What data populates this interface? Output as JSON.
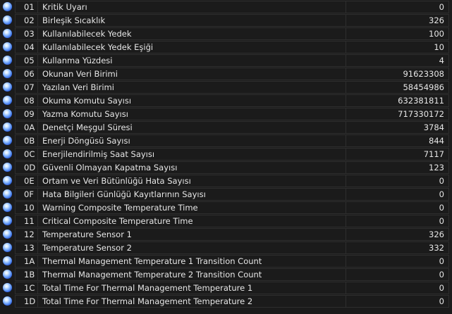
{
  "rows": [
    {
      "id": "01",
      "name": "Kritik Uyarı",
      "value": "0"
    },
    {
      "id": "02",
      "name": "Birleşik Sıcaklık",
      "value": "326"
    },
    {
      "id": "03",
      "name": "Kullanılabilecek Yedek",
      "value": "100"
    },
    {
      "id": "04",
      "name": "Kullanılabilecek Yedek Eşiği",
      "value": "10"
    },
    {
      "id": "05",
      "name": "Kullanma Yüzdesi",
      "value": "4"
    },
    {
      "id": "06",
      "name": "Okunan Veri Birimi",
      "value": "91623308"
    },
    {
      "id": "07",
      "name": "Yazılan Veri Birimi",
      "value": "58454986"
    },
    {
      "id": "08",
      "name": "Okuma Komutu Sayısı",
      "value": "632381811"
    },
    {
      "id": "09",
      "name": "Yazma Komutu Sayısı",
      "value": "717330172"
    },
    {
      "id": "0A",
      "name": "Denetçi Meşgul Süresi",
      "value": "3784"
    },
    {
      "id": "0B",
      "name": "Enerji Döngüsü Sayısı",
      "value": "844"
    },
    {
      "id": "0C",
      "name": "Enerjilendirilmiş Saat Sayısı",
      "value": "7117"
    },
    {
      "id": "0D",
      "name": "Güvenli Olmayan Kapatma Sayısı",
      "value": "123"
    },
    {
      "id": "0E",
      "name": "Ortam ve Veri Bütünlüğü Hata Sayısı",
      "value": "0"
    },
    {
      "id": "0F",
      "name": "Hata Bilgileri Günlüğü Kayıtlarının Sayısı",
      "value": "0"
    },
    {
      "id": "10",
      "name": "Warning Composite Temperature Time",
      "value": "0"
    },
    {
      "id": "11",
      "name": "Critical Composite Temperature Time",
      "value": "0"
    },
    {
      "id": "12",
      "name": "Temperature Sensor 1",
      "value": "326"
    },
    {
      "id": "13",
      "name": "Temperature Sensor 2",
      "value": "332"
    },
    {
      "id": "1A",
      "name": "Thermal Management Temperature 1 Transition Count",
      "value": "0"
    },
    {
      "id": "1B",
      "name": "Thermal Management Temperature 2 Transition Count",
      "value": "0"
    },
    {
      "id": "1C",
      "name": "Total Time For Thermal Management Temperature 1",
      "value": "0"
    },
    {
      "id": "1D",
      "name": "Total Time For Thermal Management Temperature 2",
      "value": "0"
    }
  ],
  "status_icon": "blue-orb-icon"
}
